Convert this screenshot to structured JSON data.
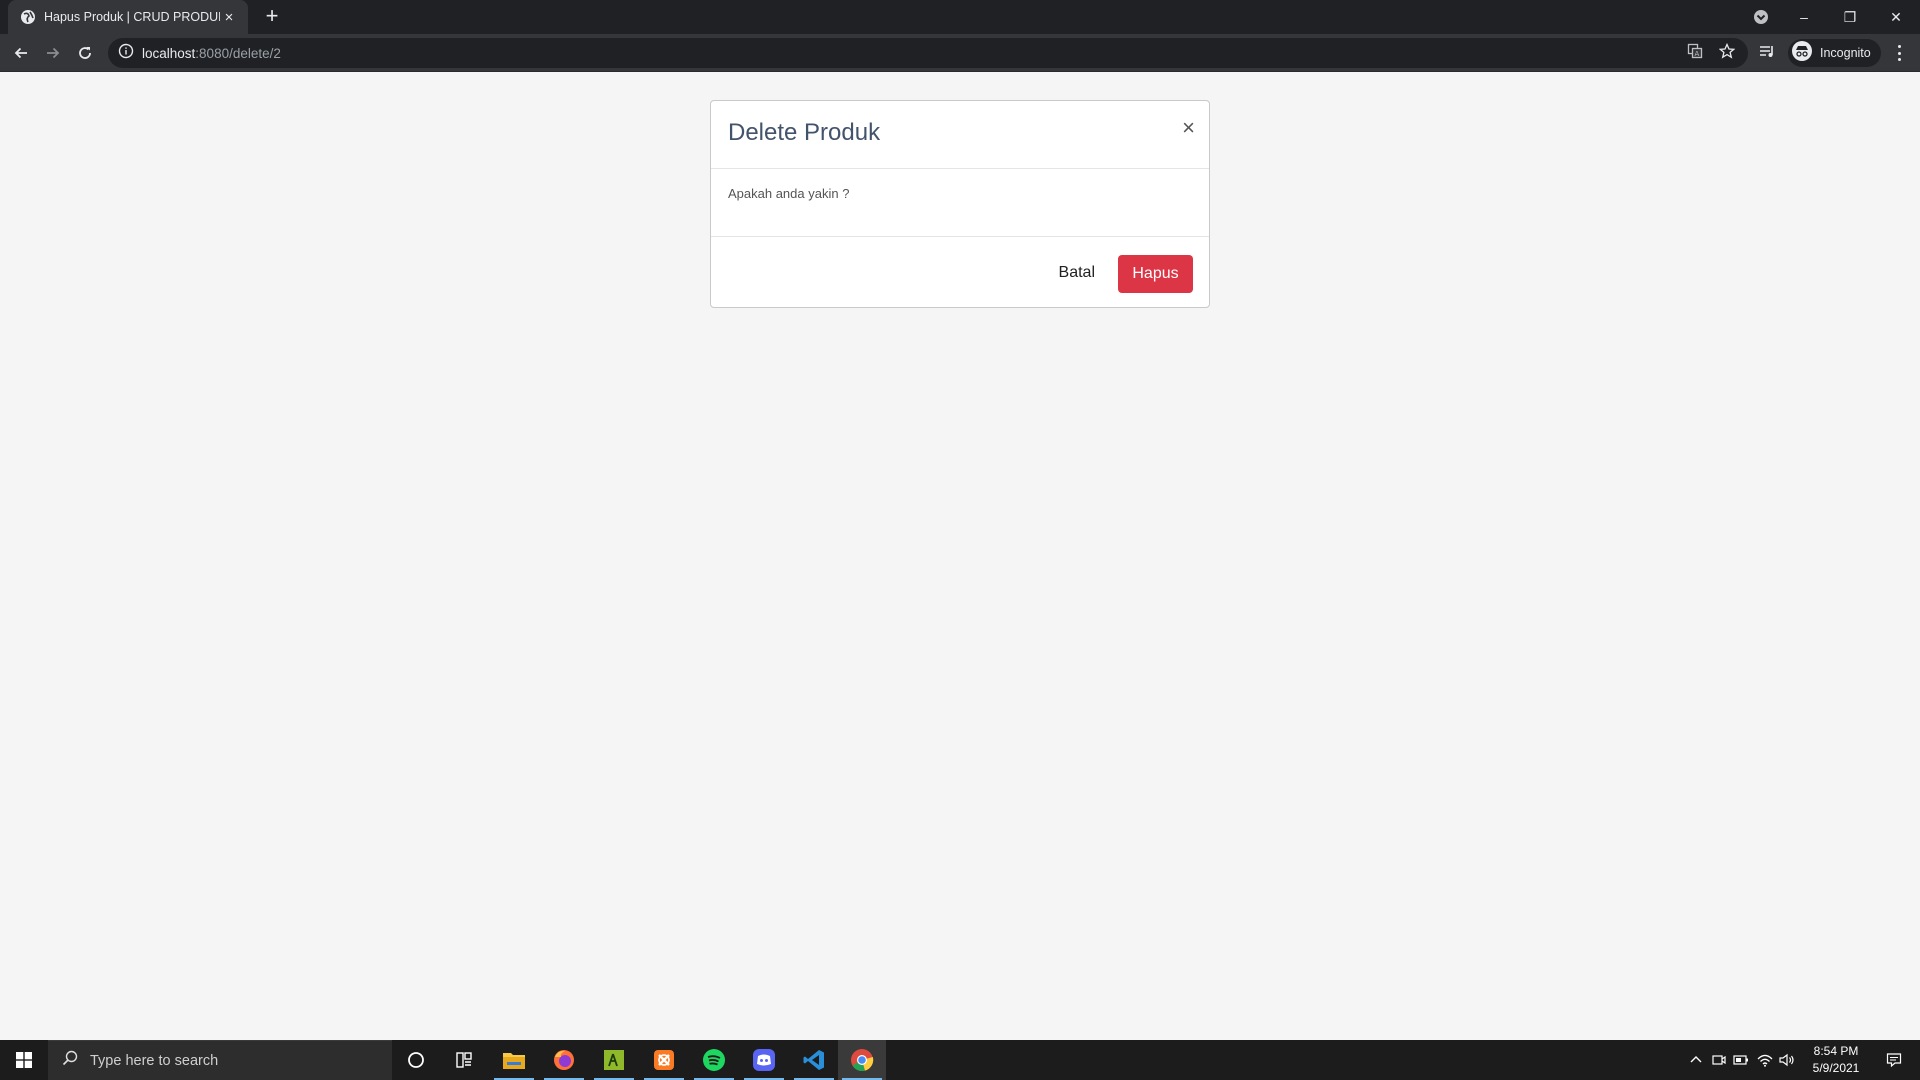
{
  "browser": {
    "tab_title": "Hapus Produk | CRUD PRODUK",
    "tab_close": "×",
    "new_tab": "+",
    "url_host": "localhost",
    "url_rest": ":8080/delete/2",
    "profile_label": "Incognito",
    "window_minimize": "–",
    "window_restore": "❐",
    "window_close": "✕"
  },
  "modal": {
    "title": "Delete Produk",
    "close": "×",
    "message": "Apakah anda yakin ?",
    "cancel_label": "Batal",
    "confirm_label": "Hapus",
    "confirm_color": "#dc3545"
  },
  "taskbar": {
    "search_placeholder": "Type here to search",
    "time": "8:54 PM",
    "date": "5/9/2021",
    "apps": [
      "file-explorer-icon",
      "firefox-icon",
      "evolus-pencil-icon",
      "xampp-icon",
      "spotify-icon",
      "discord-icon",
      "vscode-icon",
      "chrome-icon"
    ]
  }
}
